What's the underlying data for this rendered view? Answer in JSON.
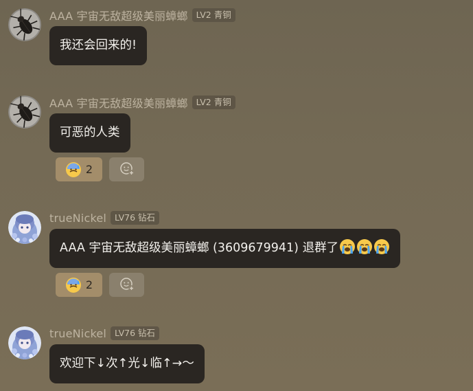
{
  "messages": [
    {
      "name": "AAA 宇宙无敌超级美丽蟑螂",
      "badge": "LV2 青铜",
      "avatar": "cockroach-avatar",
      "text": "我还会回来的!"
    },
    {
      "name": "AAA 宇宙无敌超级美丽蟑螂",
      "badge": "LV2 青铜",
      "avatar": "cockroach-avatar",
      "text": "可恶的人类",
      "reaction": {
        "emoji": "anxious-sweat-emoji",
        "count": "2"
      }
    },
    {
      "name": "trueNickel",
      "badge": "LV76 钻石",
      "avatar": "anime-character-avatar",
      "text": "AAA 宇宙无敌超级美丽蟑螂 (3609679941) 退群了",
      "trailing_emoji": [
        "crying-emoji",
        "crying-emoji",
        "crying-emoji"
      ],
      "reaction": {
        "emoji": "anxious-sweat-emoji",
        "count": "2"
      }
    },
    {
      "name": "trueNickel",
      "badge": "LV76 钻石",
      "avatar": "anime-character-avatar",
      "text": "欢迎下↓次↑光↓临↑→～"
    }
  ],
  "colors": {
    "bubble": "#2a2622",
    "reaction_active": "#a38d6a",
    "reaction_add": "#8a806d",
    "name": "#bdb3a0"
  }
}
